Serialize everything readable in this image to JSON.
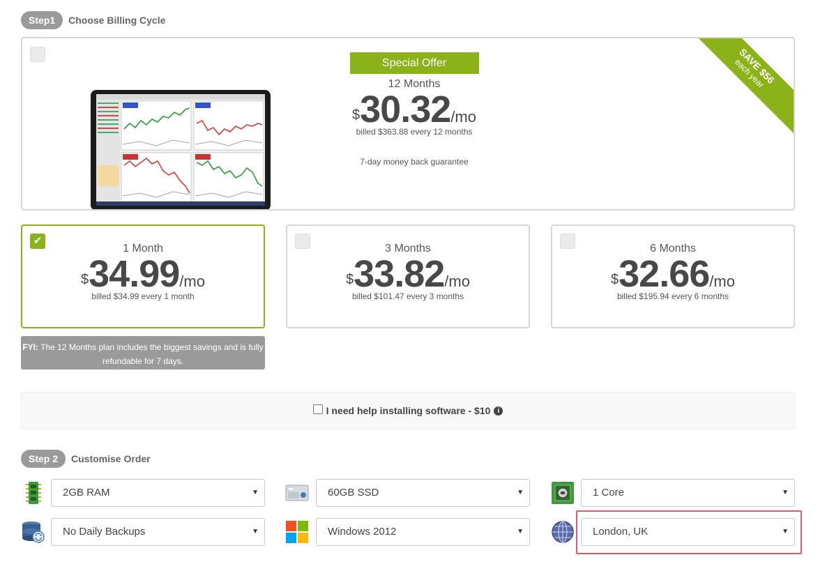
{
  "step1": {
    "badge": "Step1",
    "title": "Choose Billing Cycle"
  },
  "featured": {
    "badge": "Special Offer",
    "months": "12 Months",
    "currency": "$",
    "amount": "30.32",
    "per": "/mo",
    "billed": "billed $363.88 every 12 months",
    "guarantee": "7-day money back guarantee",
    "ribbon_line1": "SAVE $56",
    "ribbon_line2": "each year",
    "selected": false
  },
  "plans": [
    {
      "months": "1 Month",
      "currency": "$",
      "amount": "34.99",
      "per": "/mo",
      "billed": "billed $34.99 every 1 month",
      "selected": true
    },
    {
      "months": "3 Months",
      "currency": "$",
      "amount": "33.82",
      "per": "/mo",
      "billed": "billed $101.47 every 3 months",
      "selected": false
    },
    {
      "months": "6 Months",
      "currency": "$",
      "amount": "32.66",
      "per": "/mo",
      "billed": "billed $195.94 every 6 months",
      "selected": false
    }
  ],
  "fyi": {
    "label": "FYI:",
    "text": " The 12 Months plan includes the biggest savings and is fully refundable for 7 days."
  },
  "help": {
    "label": "I need help installing software - $10",
    "checked": false,
    "info_icon": "info-icon"
  },
  "step2": {
    "badge": "Step 2",
    "title": "Customise Order"
  },
  "options": {
    "ram": {
      "value": "2GB RAM",
      "icon": "ram-icon"
    },
    "storage": {
      "value": "60GB SSD",
      "icon": "ssd-icon"
    },
    "cpu": {
      "value": "1 Core",
      "icon": "cpu-icon"
    },
    "backups": {
      "value": "No Daily Backups",
      "icon": "backup-icon"
    },
    "os": {
      "value": "Windows 2012",
      "icon": "windows-icon"
    },
    "location": {
      "value": "London, UK",
      "icon": "globe-icon"
    }
  },
  "colors": {
    "accent": "#8cb21a",
    "pill": "#9a9a9a",
    "highlight": "#e05a66"
  }
}
